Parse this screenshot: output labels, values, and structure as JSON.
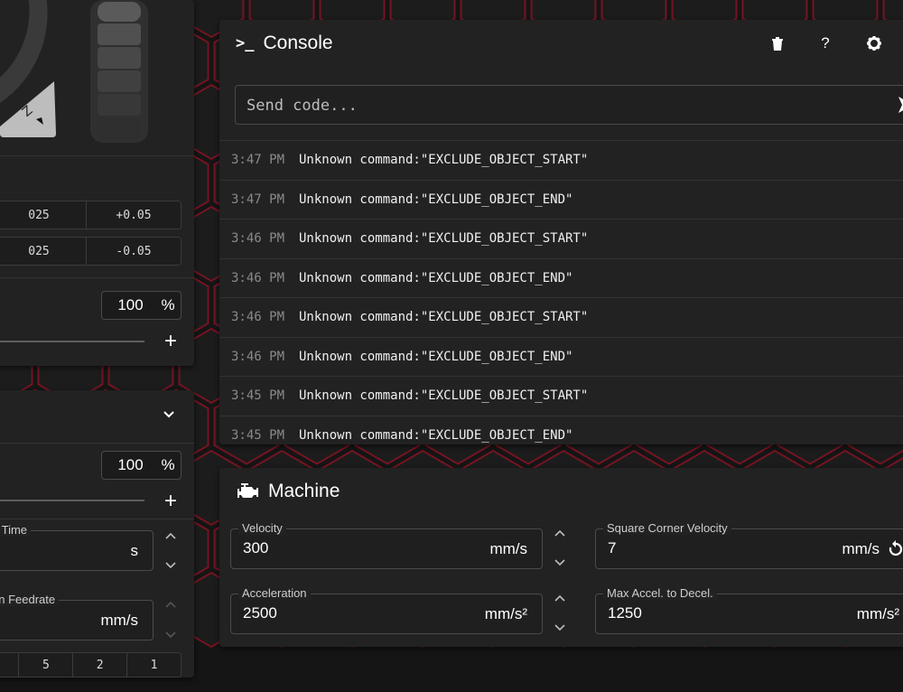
{
  "left_panel": {
    "step_rows": [
      [
        "025",
        "+0.05"
      ],
      [
        "025",
        "-0.05"
      ]
    ],
    "speed_factor": {
      "value": "100",
      "unit": "%"
    },
    "flow_factor": {
      "value": "100",
      "unit": "%"
    },
    "smooth_time": {
      "label": "n Time",
      "unit": "s"
    },
    "feedrate": {
      "label": "on Feedrate",
      "unit": "mm/s"
    },
    "step_buttons": [
      "5",
      "2",
      "1"
    ],
    "plus_label": "+"
  },
  "console": {
    "title": "Console",
    "prompt_icon": ">_",
    "help_label": "?",
    "send_placeholder": "Send code...",
    "entries": [
      {
        "time": "3:47 PM",
        "message": "Unknown command:\"EXCLUDE_OBJECT_START\""
      },
      {
        "time": "3:47 PM",
        "message": "Unknown command:\"EXCLUDE_OBJECT_END\""
      },
      {
        "time": "3:46 PM",
        "message": "Unknown command:\"EXCLUDE_OBJECT_START\""
      },
      {
        "time": "3:46 PM",
        "message": "Unknown command:\"EXCLUDE_OBJECT_END\""
      },
      {
        "time": "3:46 PM",
        "message": "Unknown command:\"EXCLUDE_OBJECT_START\""
      },
      {
        "time": "3:46 PM",
        "message": "Unknown command:\"EXCLUDE_OBJECT_END\""
      },
      {
        "time": "3:45 PM",
        "message": "Unknown command:\"EXCLUDE_OBJECT_START\""
      },
      {
        "time": "3:45 PM",
        "message": "Unknown command:\"EXCLUDE_OBJECT_END\""
      }
    ]
  },
  "machine": {
    "title": "Machine",
    "velocity": {
      "label": "Velocity",
      "value": "300",
      "unit": "mm/s"
    },
    "square_corner_velocity": {
      "label": "Square Corner Velocity",
      "value": "7",
      "unit": "mm/s"
    },
    "acceleration": {
      "label": "Acceleration",
      "value": "2500",
      "unit": "mm/s²"
    },
    "max_accel_to_decel": {
      "label": "Max Accel. to Decel.",
      "value": "1250",
      "unit": "mm/s²"
    }
  },
  "colors": {
    "accent_red": "#c0122c",
    "card_bg": "#222222",
    "page_bg": "#151515"
  }
}
